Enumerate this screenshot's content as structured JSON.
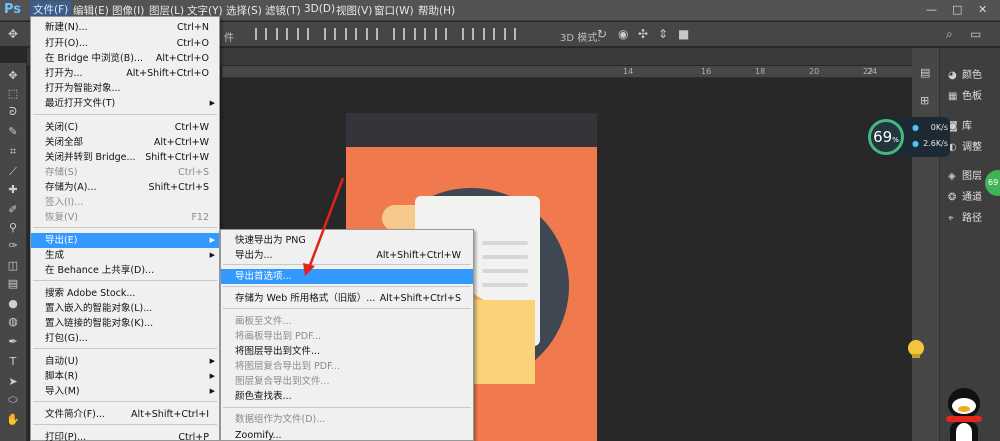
{
  "app": {
    "logo": "Ps"
  },
  "menubar": {
    "items": [
      "文件(F)",
      "编辑(E)",
      "图像(I)",
      "图层(L)",
      "文字(Y)",
      "选择(S)",
      "滤镜(T)",
      "3D(D)",
      "视图(V)",
      "窗口(W)",
      "帮助(H)"
    ],
    "window_controls": [
      "—",
      "□",
      "✕"
    ]
  },
  "optionsbar": {
    "truncated_label": "件",
    "mode_label": "3D 模式:"
  },
  "ruler": {
    "ticks": [
      "14",
      "16",
      "18",
      "20",
      "22",
      "24"
    ]
  },
  "file_menu": {
    "items": [
      {
        "label": "新建(N)...",
        "shortcut": "Ctrl+N"
      },
      {
        "label": "打开(O)...",
        "shortcut": "Ctrl+O"
      },
      {
        "label": "在 Bridge 中浏览(B)...",
        "shortcut": "Alt+Ctrl+O"
      },
      {
        "label": "打开为...",
        "shortcut": "Alt+Shift+Ctrl+O"
      },
      {
        "label": "打开为智能对象...",
        "shortcut": ""
      },
      {
        "label": "最近打开文件(T)",
        "shortcut": ""
      },
      {
        "label": "关闭(C)",
        "shortcut": "Ctrl+W"
      },
      {
        "label": "关闭全部",
        "shortcut": "Alt+Ctrl+W"
      },
      {
        "label": "关闭并转到 Bridge...",
        "shortcut": "Shift+Ctrl+W"
      },
      {
        "label": "存储(S)",
        "shortcut": "Ctrl+S"
      },
      {
        "label": "存储为(A)...",
        "shortcut": "Shift+Ctrl+S"
      },
      {
        "label": "签入(I)...",
        "shortcut": ""
      },
      {
        "label": "恢复(V)",
        "shortcut": "F12"
      },
      {
        "label": "导出(E)",
        "shortcut": ""
      },
      {
        "label": "生成",
        "shortcut": ""
      },
      {
        "label": "在 Behance 上共享(D)...",
        "shortcut": ""
      },
      {
        "label": "搜索 Adobe Stock...",
        "shortcut": ""
      },
      {
        "label": "置入嵌入的智能对象(L)...",
        "shortcut": ""
      },
      {
        "label": "置入链接的智能对象(K)...",
        "shortcut": ""
      },
      {
        "label": "打包(G)...",
        "shortcut": ""
      },
      {
        "label": "自动(U)",
        "shortcut": ""
      },
      {
        "label": "脚本(R)",
        "shortcut": ""
      },
      {
        "label": "导入(M)",
        "shortcut": ""
      },
      {
        "label": "文件简介(F)...",
        "shortcut": "Alt+Shift+Ctrl+I"
      },
      {
        "label": "打印(P)...",
        "shortcut": "Ctrl+P"
      }
    ]
  },
  "export_menu": {
    "items": [
      {
        "label": "快速导出为 PNG",
        "shortcut": ""
      },
      {
        "label": "导出为...",
        "shortcut": "Alt+Shift+Ctrl+W"
      },
      {
        "label": "导出首选项...",
        "shortcut": ""
      },
      {
        "label": "存储为 Web 所用格式（旧版）...",
        "shortcut": "Alt+Shift+Ctrl+S"
      },
      {
        "label": "画板至文件...",
        "shortcut": ""
      },
      {
        "label": "将画板导出到 PDF...",
        "shortcut": ""
      },
      {
        "label": "将图层导出到文件...",
        "shortcut": ""
      },
      {
        "label": "将图层复合导出到 PDF...",
        "shortcut": ""
      },
      {
        "label": "图层复合导出到文件...",
        "shortcut": ""
      },
      {
        "label": "颜色查找表...",
        "shortcut": ""
      },
      {
        "label": "数据组作为文件(D)...",
        "shortcut": ""
      },
      {
        "label": "Zoomify...",
        "shortcut": ""
      }
    ]
  },
  "right_panel": {
    "items": [
      "颜色",
      "色板",
      "库",
      "调整",
      "图层",
      "通道",
      "路径"
    ]
  },
  "widget": {
    "percent": "69",
    "percent_unit": "%",
    "up_speed": "0K/s",
    "down_speed": "2.6K/s",
    "badge": "69"
  }
}
